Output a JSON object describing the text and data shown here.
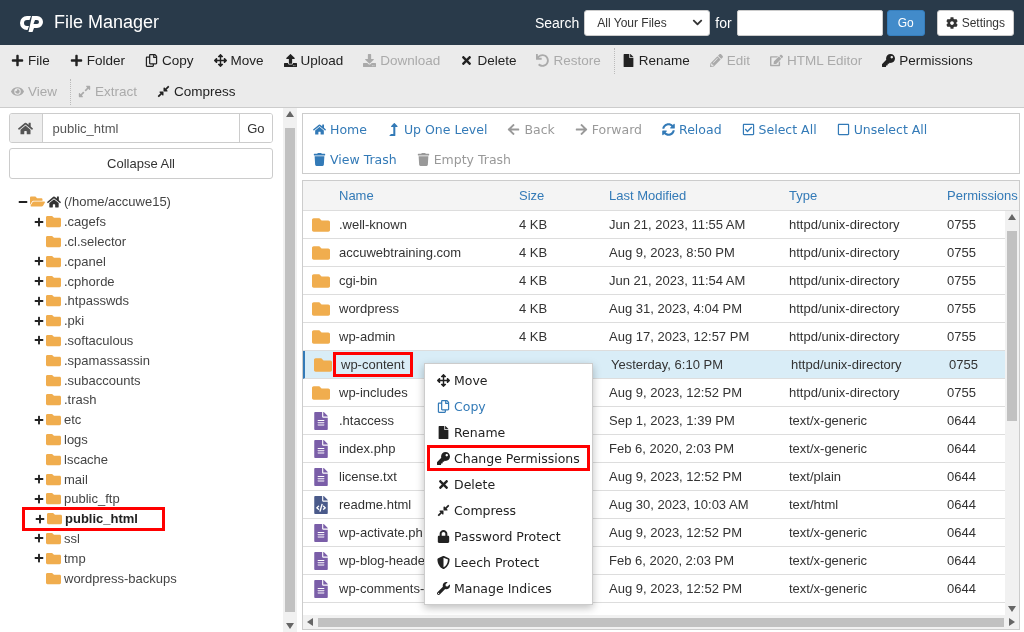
{
  "header": {
    "title": "File Manager",
    "search_label": "Search",
    "search_scope": "All Your Files",
    "for_label": "for",
    "go": "Go",
    "settings": "Settings"
  },
  "toolbar": [
    [
      {
        "label": "File",
        "disabled": false
      },
      {
        "label": "Folder",
        "disabled": false
      },
      {
        "label": "Copy",
        "disabled": false
      },
      {
        "label": "Move",
        "disabled": false
      },
      {
        "label": "Upload",
        "disabled": false
      },
      {
        "label": "Download",
        "disabled": true
      },
      {
        "label": "Delete",
        "disabled": false
      },
      {
        "label": "Restore",
        "disabled": true
      },
      {
        "label": "Rename",
        "disabled": false
      },
      {
        "label": "Edit",
        "disabled": true
      },
      {
        "label": "HTML Editor",
        "disabled": true
      },
      {
        "label": "Permissions",
        "disabled": false
      }
    ],
    [
      {
        "label": "View",
        "disabled": true
      },
      {
        "label": "Extract",
        "disabled": true
      },
      {
        "label": "Compress",
        "disabled": false
      }
    ]
  ],
  "path_bar": {
    "value": "public_html",
    "go": "Go"
  },
  "collapse_all": "Collapse All",
  "tree": {
    "label": "(/home/accuwe15)",
    "expanded": true,
    "children": [
      {
        "label": ".cagefs",
        "expandable": true,
        "selected": false,
        "highlighted": false
      },
      {
        "label": ".cl.selector",
        "expandable": false,
        "selected": false,
        "highlighted": false
      },
      {
        "label": ".cpanel",
        "expandable": true,
        "selected": false,
        "highlighted": false
      },
      {
        "label": ".cphorde",
        "expandable": true,
        "selected": false,
        "highlighted": false
      },
      {
        "label": ".htpasswds",
        "expandable": true,
        "selected": false,
        "highlighted": false
      },
      {
        "label": ".pki",
        "expandable": true,
        "selected": false,
        "highlighted": false
      },
      {
        "label": ".softaculous",
        "expandable": true,
        "selected": false,
        "highlighted": false
      },
      {
        "label": ".spamassassin",
        "expandable": false,
        "selected": false,
        "highlighted": false
      },
      {
        "label": ".subaccounts",
        "expandable": false,
        "selected": false,
        "highlighted": false
      },
      {
        "label": ".trash",
        "expandable": false,
        "selected": false,
        "highlighted": false
      },
      {
        "label": "etc",
        "expandable": true,
        "selected": false,
        "highlighted": false
      },
      {
        "label": "logs",
        "expandable": false,
        "selected": false,
        "highlighted": false
      },
      {
        "label": "lscache",
        "expandable": false,
        "selected": false,
        "highlighted": false
      },
      {
        "label": "mail",
        "expandable": true,
        "selected": false,
        "highlighted": false
      },
      {
        "label": "public_ftp",
        "expandable": true,
        "selected": false,
        "highlighted": false
      },
      {
        "label": "public_html",
        "expandable": true,
        "selected": true,
        "highlighted": true
      },
      {
        "label": "ssl",
        "expandable": true,
        "selected": false,
        "highlighted": false
      },
      {
        "label": "tmp",
        "expandable": true,
        "selected": false,
        "highlighted": false
      },
      {
        "label": "wordpress-backups",
        "expandable": false,
        "selected": false,
        "highlighted": false
      }
    ]
  },
  "nav": [
    [
      {
        "label": "Home",
        "disabled": false
      },
      {
        "label": "Up One Level",
        "disabled": false
      },
      {
        "label": "Back",
        "disabled": true
      },
      {
        "label": "Forward",
        "disabled": true
      },
      {
        "label": "Reload",
        "disabled": false
      },
      {
        "label": "Select All",
        "disabled": false
      },
      {
        "label": "Unselect All",
        "disabled": false
      }
    ],
    [
      {
        "label": "View Trash",
        "disabled": false
      },
      {
        "label": "Empty Trash",
        "disabled": true
      }
    ]
  ],
  "table": {
    "columns": [
      "Name",
      "Size",
      "Last Modified",
      "Type",
      "Permissions"
    ],
    "rows": [
      {
        "kind": "folder",
        "name": ".well-known",
        "size": "4 KB",
        "modified": "Jun 21, 2023, 11:55 AM",
        "type": "httpd/unix-directory",
        "perms": "0755",
        "selected": false,
        "highlighted": false
      },
      {
        "kind": "folder",
        "name": "accuwebtraining.com",
        "size": "4 KB",
        "modified": "Aug 9, 2023, 8:50 PM",
        "type": "httpd/unix-directory",
        "perms": "0755",
        "selected": false,
        "highlighted": false
      },
      {
        "kind": "folder",
        "name": "cgi-bin",
        "size": "4 KB",
        "modified": "Jun 21, 2023, 11:54 AM",
        "type": "httpd/unix-directory",
        "perms": "0755",
        "selected": false,
        "highlighted": false
      },
      {
        "kind": "folder",
        "name": "wordpress",
        "size": "4 KB",
        "modified": "Aug 31, 2023, 4:04 PM",
        "type": "httpd/unix-directory",
        "perms": "0755",
        "selected": false,
        "highlighted": false
      },
      {
        "kind": "folder",
        "name": "wp-admin",
        "size": "4 KB",
        "modified": "Aug 17, 2023, 12:57 PM",
        "type": "httpd/unix-directory",
        "perms": "0755",
        "selected": false,
        "highlighted": false
      },
      {
        "kind": "folder",
        "name": "wp-content",
        "modified": "Yesterday, 6:10 PM",
        "type": "httpd/unix-directory",
        "perms": "0755",
        "selected": true,
        "highlighted": true
      },
      {
        "kind": "folder",
        "name": "wp-includes",
        "modified": "Aug 9, 2023, 12:52 PM",
        "type": "httpd/unix-directory",
        "perms": "0755",
        "selected": false,
        "highlighted": false
      },
      {
        "kind": "file",
        "name": ".htaccess",
        "modified": "Sep 1, 2023, 1:39 PM",
        "type": "text/x-generic",
        "perms": "0644",
        "selected": false,
        "highlighted": false
      },
      {
        "kind": "file",
        "name": "index.php",
        "modified": "Feb 6, 2020, 2:03 PM",
        "type": "text/x-generic",
        "perms": "0644",
        "selected": false,
        "highlighted": false
      },
      {
        "kind": "file",
        "name": "license.txt",
        "modified": "Aug 9, 2023, 12:52 PM",
        "type": "text/plain",
        "perms": "0644",
        "selected": false,
        "highlighted": false
      },
      {
        "kind": "code",
        "name": "readme.html",
        "modified": "Aug 30, 2023, 10:03 AM",
        "type": "text/html",
        "perms": "0644",
        "selected": false,
        "highlighted": false
      },
      {
        "kind": "file",
        "name": "wp-activate.ph",
        "modified": "Aug 9, 2023, 12:52 PM",
        "type": "text/x-generic",
        "perms": "0644",
        "selected": false,
        "highlighted": false
      },
      {
        "kind": "file",
        "name": "wp-blog-heade",
        "modified": "Feb 6, 2020, 2:03 PM",
        "type": "text/x-generic",
        "perms": "0644",
        "selected": false,
        "highlighted": false
      },
      {
        "kind": "file",
        "name": "wp-comments-",
        "modified": "Aug 9, 2023, 12:52 PM",
        "type": "text/x-generic",
        "perms": "0644",
        "selected": false,
        "highlighted": false
      }
    ]
  },
  "context_menu": [
    {
      "label": "Move",
      "active": false,
      "highlighted": false
    },
    {
      "label": "Copy",
      "active": true,
      "highlighted": false
    },
    {
      "label": "Rename",
      "active": false,
      "highlighted": false
    },
    {
      "label": "Change Permissions",
      "active": false,
      "highlighted": true
    },
    {
      "label": "Delete",
      "active": false,
      "highlighted": false
    },
    {
      "label": "Compress",
      "active": false,
      "highlighted": false
    },
    {
      "label": "Password Protect",
      "active": false,
      "highlighted": false
    },
    {
      "label": "Leech Protect",
      "active": false,
      "highlighted": false
    },
    {
      "label": "Manage Indices",
      "active": false,
      "highlighted": false
    }
  ]
}
